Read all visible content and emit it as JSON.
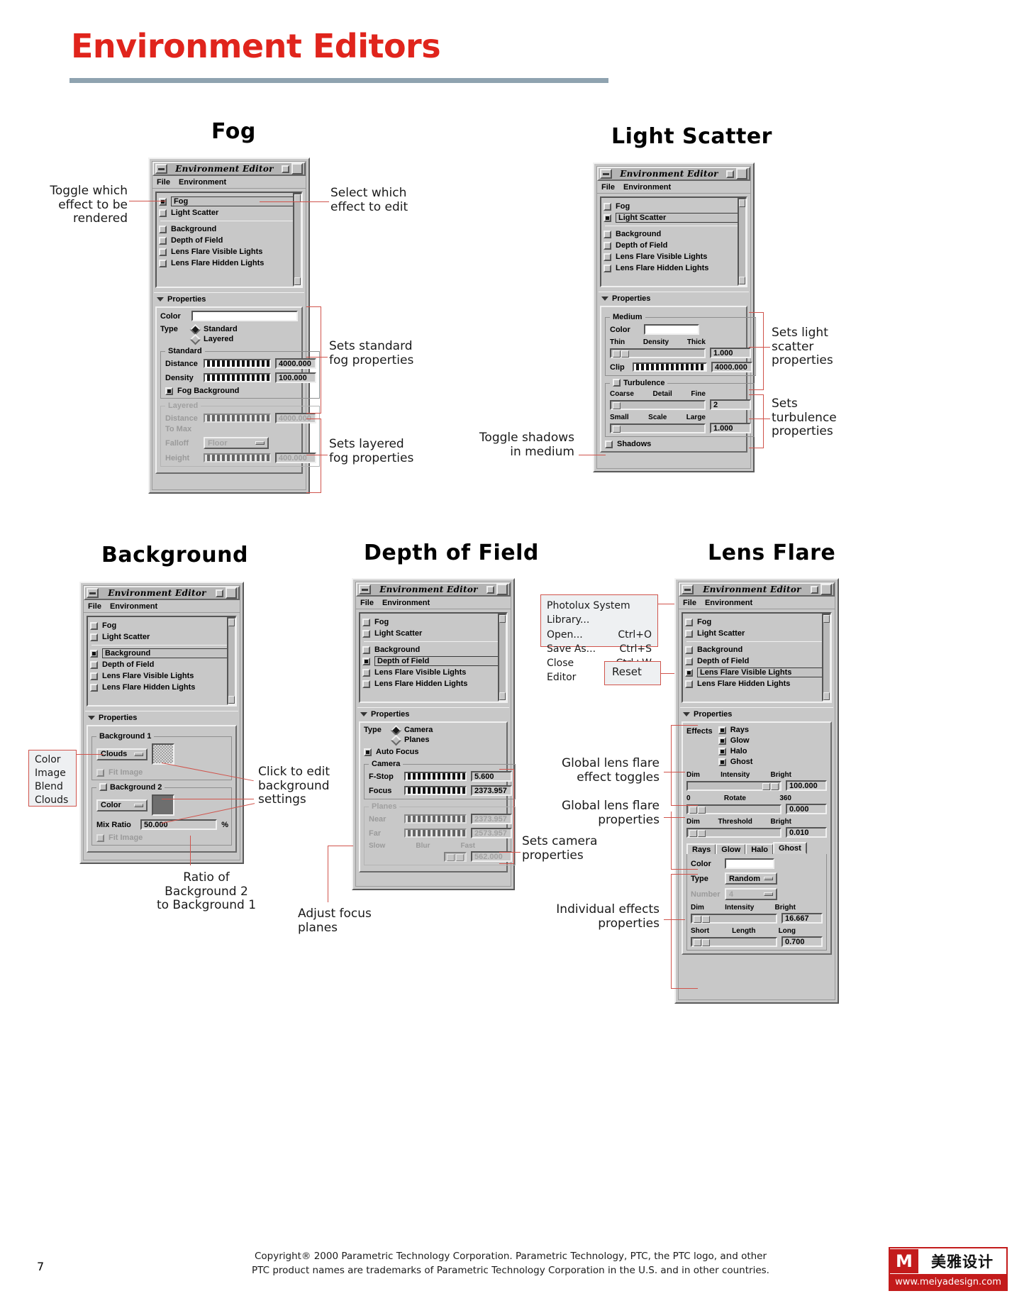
{
  "page": {
    "title": "Environment Editors",
    "page_number": "7",
    "copyright_line1": "Copyright® 2000 Parametric Technology Corporation. Parametric Technology, PTC, the PTC logo, and other",
    "copyright_line2": "PTC product names are trademarks of Parametric Technology Corporation in the U.S. and in other countries.",
    "logo_mark": "M",
    "logo_cn": "美雅设计",
    "logo_url": "www.meiyadesign.com"
  },
  "sections": {
    "fog": "Fog",
    "light_scatter": "Light Scatter",
    "background": "Background",
    "depth_of_field": "Depth of Field",
    "lens_flare": "Lens Flare"
  },
  "window": {
    "title": "Environment Editor",
    "menu": [
      "File",
      "Environment"
    ],
    "properties_label": "Properties"
  },
  "effect_list": [
    "Fog",
    "Light Scatter",
    "Background",
    "Depth of Field",
    "Lens Flare Visible Lights",
    "Lens Flare Hidden Lights"
  ],
  "fog_panel": {
    "checked": "Fog",
    "selected": "Fog",
    "color_label": "Color",
    "type_label": "Type",
    "type_options": [
      "Standard",
      "Layered"
    ],
    "type_selected": "Standard",
    "standard_group": "Standard",
    "distance_label": "Distance",
    "distance_value": "4000.000",
    "density_label": "Density",
    "density_value": "100.000",
    "fog_background_label": "Fog Background",
    "fog_background_checked": true,
    "layered_group": "Layered",
    "layered_distance_label": "Distance",
    "layered_tomax_label": "To Max",
    "layered_distance_value": "4000.000",
    "falloff_label": "Falloff",
    "falloff_value": "Floor",
    "height_label": "Height",
    "height_value": "400.000"
  },
  "light_scatter_panel": {
    "checked": "Light Scatter",
    "selected": "Light Scatter",
    "medium_group": "Medium",
    "color_label": "Color",
    "thin_label": "Thin",
    "density_label": "Density",
    "thick_label": "Thick",
    "density_value": "1.000",
    "clip_label": "Clip",
    "clip_value": "4000.000",
    "turbulence_group": "Turbulence",
    "turbulence_checked": false,
    "coarse_label": "Coarse",
    "detail_label": "Detail",
    "fine_label": "Fine",
    "detail_value": "2",
    "small_label": "Small",
    "scale_label": "Scale",
    "large_label": "Large",
    "scale_value": "1.000",
    "shadows_label": "Shadows",
    "shadows_checked": false
  },
  "background_panel": {
    "checked": "Background",
    "selected": "Background",
    "bg1_group": "Background 1",
    "bg1_type": "Clouds",
    "bg1_fit_image": "Fit Image",
    "bg2_group": "Background 2",
    "bg2_checked": false,
    "bg2_type": "Color",
    "mix_ratio_label": "Mix Ratio",
    "mix_ratio_value": "50.000",
    "mix_ratio_unit": "%",
    "bg2_fit_image": "Fit Image"
  },
  "dof_panel": {
    "checked": "Depth of Field",
    "selected": "Depth of Field",
    "type_label": "Type",
    "type_options": [
      "Camera",
      "Planes"
    ],
    "type_selected": "Camera",
    "auto_focus_label": "Auto Focus",
    "auto_focus_checked": true,
    "camera_group": "Camera",
    "fstop_label": "F-Stop",
    "fstop_value": "5.600",
    "focus_label": "Focus",
    "focus_value": "2373.957",
    "planes_group": "Planes",
    "near_label": "Near",
    "near_value": "2373.957",
    "far_label": "Far",
    "far_value": "2573.957",
    "slow_label": "Slow",
    "blur_label": "Blur",
    "fast_label": "Fast",
    "blur_value": "562.000"
  },
  "lens_flare_panel": {
    "checked": "Lens Flare Visible Lights",
    "selected": "Lens Flare Visible Lights",
    "effects_label": "Effects",
    "effects": [
      {
        "label": "Rays",
        "checked": true
      },
      {
        "label": "Glow",
        "checked": true
      },
      {
        "label": "Halo",
        "checked": true
      },
      {
        "label": "Ghost",
        "checked": true
      }
    ],
    "dim_label": "Dim",
    "intensity_label": "Intensity",
    "bright_label": "Bright",
    "intensity_value": "100.000",
    "rotate_min": "0",
    "rotate_label": "Rotate",
    "rotate_max": "360",
    "rotate_value": "0.000",
    "threshold_label": "Threshold",
    "threshold_value": "0.010",
    "tabs": [
      "Rays",
      "Glow",
      "Halo",
      "Ghost"
    ],
    "tab_active": "Ghost",
    "color_label": "Color",
    "type_label": "Type",
    "type_value": "Random",
    "number_label": "Number",
    "number_value": "4",
    "tab_intensity_value": "16.667",
    "short_label": "Short",
    "length_label": "Length",
    "long_label": "Long",
    "length_value": "0.700"
  },
  "file_menu": {
    "items": [
      {
        "label": "Photolux System Library...",
        "accel": ""
      },
      {
        "label": "Open...",
        "accel": "Ctrl+O"
      },
      {
        "label": "Save As...",
        "accel": "Ctrl+S"
      },
      {
        "label": "Close Editor",
        "accel": "Ctrl+W"
      }
    ],
    "reset": "Reset"
  },
  "annotations": {
    "toggle_render": "Toggle which\neffect to be\nrendered",
    "select_edit": "Select which\neffect to edit",
    "standard_fog": "Sets standard\nfog properties",
    "layered_fog": "Sets layered\nfog properties",
    "light_scatter_props": "Sets light\nscatter\nproperties",
    "turbulence_props": "Sets\nturbulence\nproperties",
    "toggle_shadows": "Toggle shadows\nin medium",
    "click_edit_bg": "Click to edit\nbackground\nsettings",
    "bg_types": "Color\nImage\nBlend\nClouds",
    "ratio_note": "Ratio of\nBackground 2\nto Background 1",
    "adjust_focus": "Adjust focus\nplanes",
    "camera_props": "Sets camera\nproperties",
    "global_toggles": "Global lens flare\neffect toggles",
    "global_props": "Global lens flare\nproperties",
    "individual_props": "Individual effects\nproperties"
  }
}
